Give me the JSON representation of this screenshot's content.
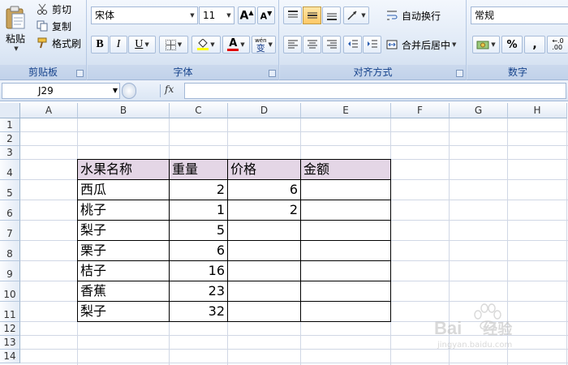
{
  "ribbon": {
    "clipboard": {
      "label": "剪贴板",
      "paste": "粘贴",
      "cut": "剪切",
      "copy": "复制",
      "format_painter": "格式刷"
    },
    "font": {
      "label": "字体",
      "font_name": "宋体",
      "font_size": "11",
      "bold": "B",
      "italic": "I",
      "underline": "U",
      "font_color_glyph": "A",
      "grow_glyph": "A",
      "shrink_glyph": "A",
      "phonetic_top": "wén",
      "phonetic_bottom": "变"
    },
    "alignment": {
      "label": "对齐方式",
      "wrap_text": "自动换行",
      "merge_center": "合并后居中"
    },
    "number": {
      "label": "数字",
      "format": "常规",
      "percent": "%",
      "comma": ","
    }
  },
  "formula_bar": {
    "name_box": "J29",
    "fx": "fx",
    "formula": ""
  },
  "columns": [
    "A",
    "B",
    "C",
    "D",
    "E",
    "F",
    "G",
    "H"
  ],
  "rows": [
    "1",
    "2",
    "3",
    "4",
    "5",
    "6",
    "7",
    "8",
    "9",
    "10",
    "11",
    "12",
    "13",
    "14"
  ],
  "table": {
    "headers": [
      "水果名称",
      "重量",
      "价格",
      "金额"
    ],
    "rows": [
      [
        "西瓜",
        "2",
        "6",
        ""
      ],
      [
        "桃子",
        "1",
        "2",
        ""
      ],
      [
        "梨子",
        "5",
        "",
        ""
      ],
      [
        "栗子",
        "6",
        "",
        ""
      ],
      [
        "桔子",
        "16",
        "",
        ""
      ],
      [
        "香蕉",
        "23",
        "",
        ""
      ],
      [
        "梨子",
        "32",
        "",
        ""
      ]
    ]
  },
  "watermark": {
    "brand": "Bai",
    "brand_suffix": "经验",
    "url": "jingyan.baidu.com"
  },
  "colors": {
    "header_fill": "#e4d6e6",
    "ribbon_label": "#15428b",
    "font_color_bar": "#e00000"
  }
}
